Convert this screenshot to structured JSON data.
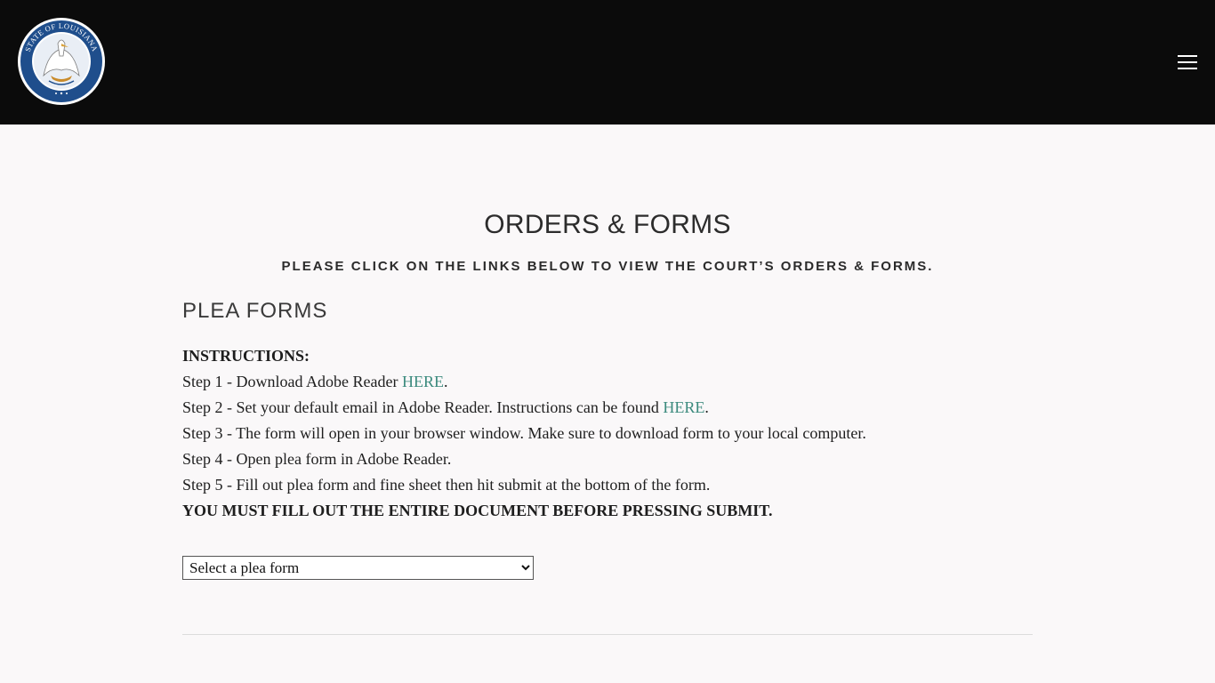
{
  "header": {
    "seal_text": "STATE OF LOUISIANA",
    "seal_motto": "UNION · JUSTICE · CONFIDENCE"
  },
  "page": {
    "title": "ORDERS & FORMS",
    "subtitle": "PLEASE CLICK ON THE LINKS BELOW TO VIEW THE COURT’S ORDERS & FORMS."
  },
  "plea": {
    "heading": "PLEA FORMS",
    "instructions_label": "INSTRUCTIONS:",
    "step1_text": "Step 1 - Download Adobe Reader ",
    "step1_link": "HERE",
    "step2_text": "Step 2 - Set your default email in Adobe Reader. Instructions can be found ",
    "step2_link": "HERE",
    "step3": "Step 3 - The form will open in your browser window. Make sure to download form to your local computer.",
    "step4": "Step 4 - Open plea form in Adobe Reader.",
    "step5": "Step 5 - Fill out plea form and fine sheet then hit submit at the bottom of the form.",
    "warning": "YOU MUST FILL OUT THE ENTIRE DOCUMENT BEFORE PRESSING SUBMIT.",
    "select_value": "Select a plea form",
    "period": "."
  },
  "colors": {
    "header_bg": "#0b0b0b",
    "link": "#3b8a7d",
    "seal_blue": "#1f4e8c"
  }
}
